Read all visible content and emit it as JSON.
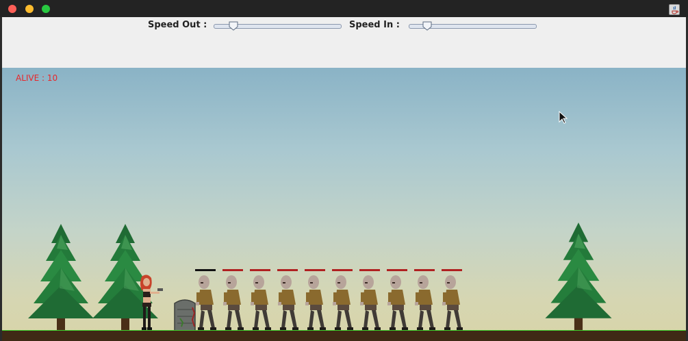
{
  "window": {
    "buttons": [
      "close",
      "minimize",
      "maximize"
    ],
    "app_icon": "java-coffee-icon"
  },
  "controls": {
    "speed_out_label": "Speed Out :",
    "speed_out_value": 0.12,
    "speed_in_label": "Speed In :",
    "speed_in_value": 0.11
  },
  "game": {
    "alive_label": "ALIVE : 10",
    "alive_count": 10,
    "player": "red-haired-gunner",
    "obstacle": "stone-tombstone",
    "zombie_count": 10,
    "trees": 3,
    "colors": {
      "alive_text": "#e8262a",
      "health_bar": "#b02020",
      "grass": "#3cd12a"
    }
  }
}
